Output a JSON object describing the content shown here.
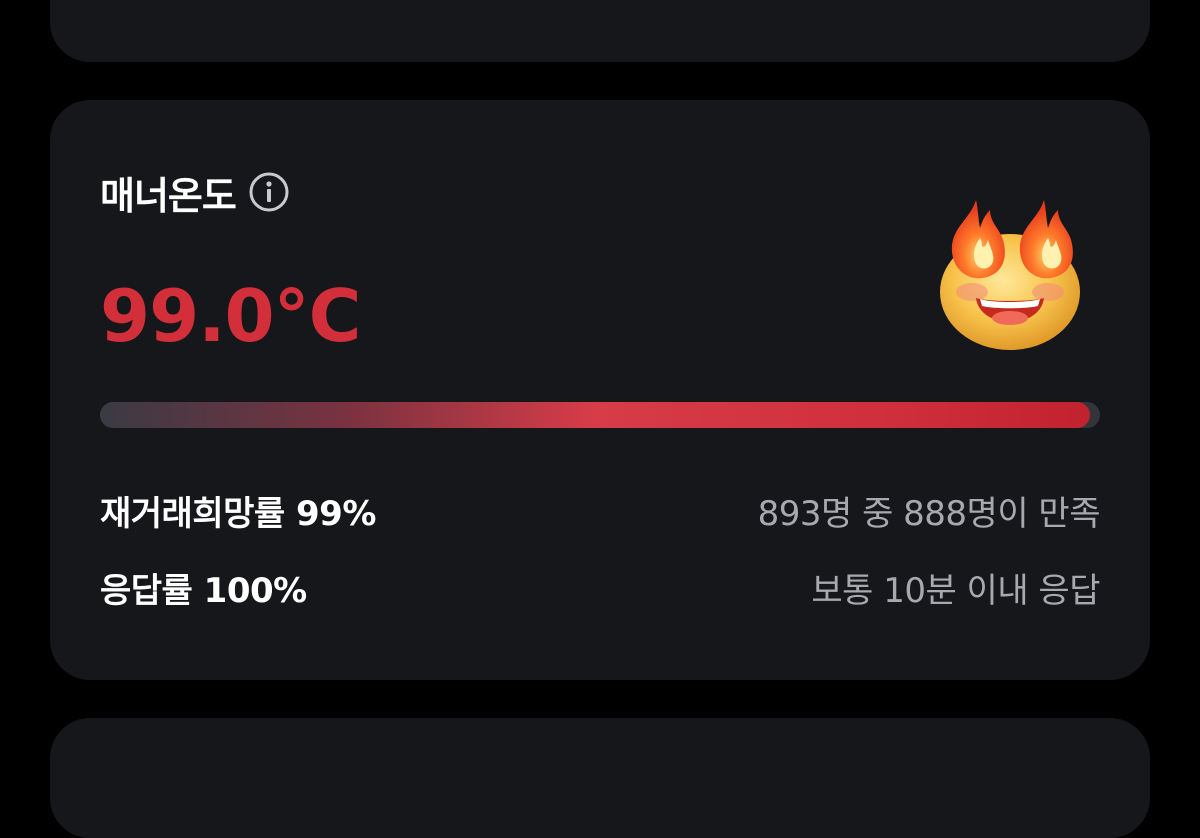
{
  "manner": {
    "title": "매너온도",
    "info_icon": "info-icon",
    "temperature": "99.0°C",
    "temperature_color": "#d22f3a",
    "progress_fraction": 0.99,
    "emoji_icon": "fire-eyes-face-icon"
  },
  "stats": {
    "rehire_label": "재거래희망률 99%",
    "rehire_detail": "893명 중 888명이 만족",
    "response_label": "응답률 100%",
    "response_detail": "보통 10분 이내 응답"
  }
}
